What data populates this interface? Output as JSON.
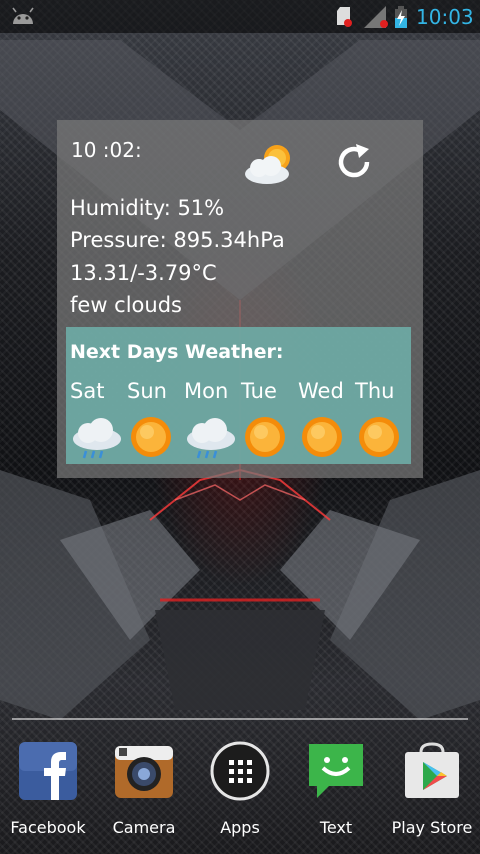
{
  "status_bar": {
    "time": "10:03",
    "accent_color": "#33b5e5",
    "icons": [
      "android-icon",
      "sd-card-icon",
      "signal-icon",
      "battery-charging-icon"
    ]
  },
  "widget": {
    "time": "10 :02:",
    "current_icon": "partly-cloudy-icon",
    "refresh_icon": "refresh-icon",
    "humidity": "Humidity:  51%",
    "pressure": "Pressure:  895.34hPa",
    "temperature": "13.31/-3.79°C",
    "condition": "few clouds",
    "forecast_title": "Next Days Weather:",
    "forecast": [
      {
        "day": "Sat",
        "icon": "rain-cloud-icon"
      },
      {
        "day": "Sun",
        "icon": "sun-icon"
      },
      {
        "day": "Mon",
        "icon": "rain-cloud-icon"
      },
      {
        "day": "Tue",
        "icon": "sun-icon"
      },
      {
        "day": "Wed",
        "icon": "sun-icon"
      },
      {
        "day": "Thu",
        "icon": "sun-icon"
      }
    ],
    "colors": {
      "panel": "#787878",
      "forecast_panel": "#6eaaa5"
    }
  },
  "dock": {
    "apps": [
      {
        "label": "Facebook",
        "icon": "facebook-icon"
      },
      {
        "label": "Camera",
        "icon": "camera-icon"
      },
      {
        "label": "Apps",
        "icon": "app-drawer-icon"
      },
      {
        "label": "Text",
        "icon": "messaging-icon"
      },
      {
        "label": "Play Store",
        "icon": "play-store-icon"
      }
    ]
  }
}
